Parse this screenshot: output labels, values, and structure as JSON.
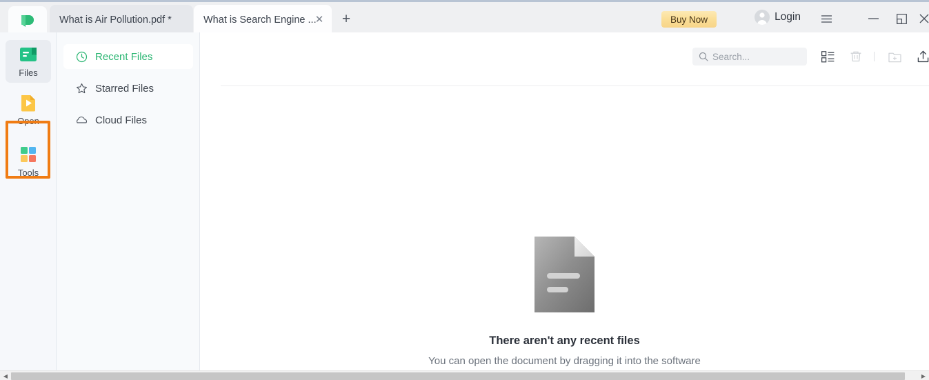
{
  "window": {
    "tabs": [
      {
        "label": "What is Air Pollution.pdf *",
        "active": false,
        "closable": false
      },
      {
        "label": "What is Search Engine ...",
        "active": true,
        "closable": true
      }
    ],
    "new_tab_label": "+",
    "buy_now_label": "Buy Now",
    "login_label": "Login",
    "controls": {
      "menu": "☰",
      "minimize": "—",
      "restore": "restore",
      "close": "✕"
    },
    "logo_icon": "pdfelement-logo-icon"
  },
  "rail": {
    "items": [
      {
        "label": "Files",
        "icon": "files-icon",
        "selected": true
      },
      {
        "label": "Open",
        "icon": "open-document-icon",
        "selected": false,
        "highlighted": true
      },
      {
        "label": "Tools",
        "icon": "tools-grid-icon",
        "selected": false
      }
    ]
  },
  "nav": {
    "items": [
      {
        "label": "Recent Files",
        "icon": "clock-icon",
        "active": true
      },
      {
        "label": "Starred Files",
        "icon": "star-icon",
        "active": false
      },
      {
        "label": "Cloud Files",
        "icon": "cloud-icon",
        "active": false
      }
    ]
  },
  "toolbar": {
    "search_placeholder": "Search...",
    "search_value": "",
    "search_icon": "search-icon",
    "buttons": [
      {
        "name": "list-view-icon",
        "enabled": true
      },
      {
        "name": "trash-icon",
        "enabled": false
      },
      {
        "name": "new-folder-icon",
        "enabled": false
      },
      {
        "name": "upload-icon",
        "enabled": true
      }
    ]
  },
  "empty_state": {
    "icon": "document-placeholder-icon",
    "title": "There aren't any recent files",
    "subtitle": "You can open the document by dragging it into the software"
  },
  "colors": {
    "accent_green": "#2cb673",
    "highlight_orange": "#f07c13",
    "titlebar_bg": "#eff0f2",
    "rail_bg": "#f6f8fb",
    "nav_bg": "#f8fafc",
    "buy_now_gold": "#fbdf98"
  },
  "scrollbar": {
    "left_arrow": "◀",
    "right_arrow": "▶"
  }
}
